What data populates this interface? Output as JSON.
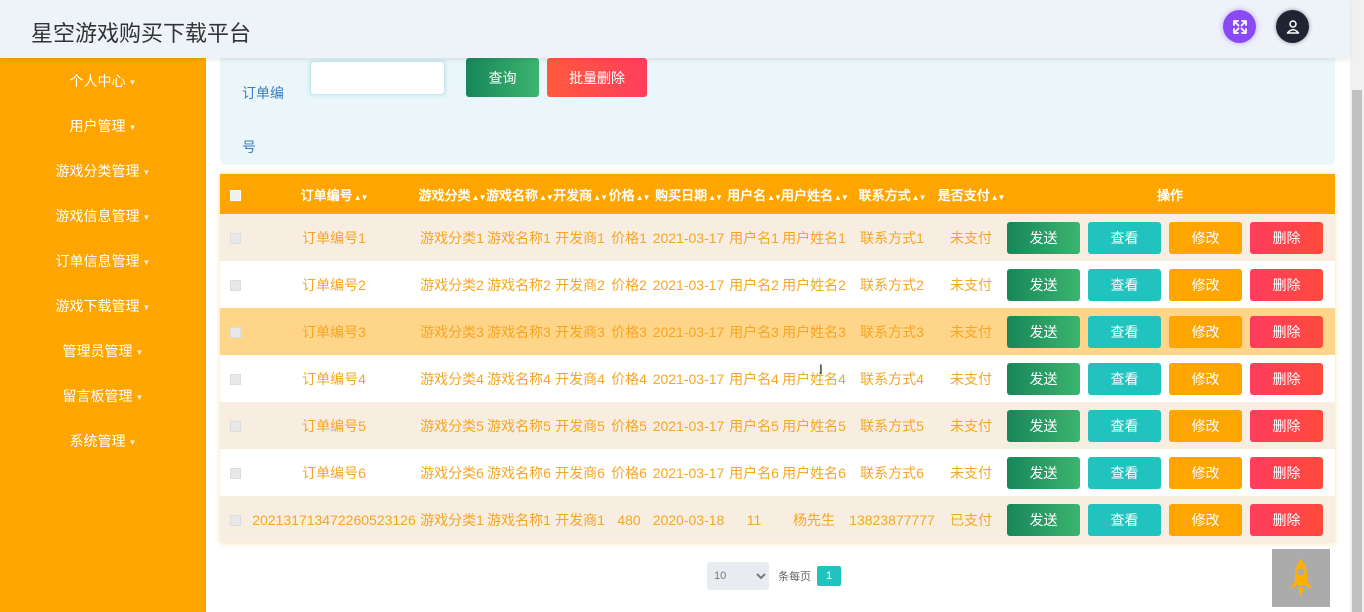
{
  "app": {
    "title": "星空游戏购买下载平台"
  },
  "header": {
    "icons": [
      "fullscreen-icon",
      "user-icon"
    ]
  },
  "sidebar": {
    "items": [
      {
        "label": "个人中心"
      },
      {
        "label": "用户管理"
      },
      {
        "label": "游戏分类管理"
      },
      {
        "label": "游戏信息管理"
      },
      {
        "label": "订单信息管理"
      },
      {
        "label": "游戏下载管理"
      },
      {
        "label": "管理员管理"
      },
      {
        "label": "留言板管理"
      },
      {
        "label": "系统管理"
      }
    ]
  },
  "search": {
    "label": "订单编号",
    "value": "",
    "placeholder": "",
    "query_label": "查询",
    "batch_delete_label": "批量删除"
  },
  "table": {
    "columns": [
      "订单编号",
      "游戏分类",
      "游戏名称",
      "开发商",
      "价格",
      "购买日期",
      "用户名",
      "用户姓名",
      "联系方式",
      "是否支付",
      "操作"
    ],
    "actions": {
      "send": "发送",
      "view": "查看",
      "edit": "修改",
      "delete": "删除"
    },
    "rows": [
      [
        "订单编号1",
        "游戏分类1",
        "游戏名称1",
        "开发商1",
        "价格1",
        "2021-03-17",
        "用户名1",
        "用户姓名1",
        "联系方式1",
        "未支付"
      ],
      [
        "订单编号2",
        "游戏分类2",
        "游戏名称2",
        "开发商2",
        "价格2",
        "2021-03-17",
        "用户名2",
        "用户姓名2",
        "联系方式2",
        "未支付"
      ],
      [
        "订单编号3",
        "游戏分类3",
        "游戏名称3",
        "开发商3",
        "价格3",
        "2021-03-17",
        "用户名3",
        "用户姓名3",
        "联系方式3",
        "未支付"
      ],
      [
        "订单编号4",
        "游戏分类4",
        "游戏名称4",
        "开发商4",
        "价格4",
        "2021-03-17",
        "用户名4",
        "用户姓名4",
        "联系方式4",
        "未支付"
      ],
      [
        "订单编号5",
        "游戏分类5",
        "游戏名称5",
        "开发商5",
        "价格5",
        "2021-03-17",
        "用户名5",
        "用户姓名5",
        "联系方式5",
        "未支付"
      ],
      [
        "订单编号6",
        "游戏分类6",
        "游戏名称6",
        "开发商6",
        "价格6",
        "2021-03-17",
        "用户名6",
        "用户姓名6",
        "联系方式6",
        "未支付"
      ],
      [
        "20213171347226052312​6",
        "游戏分类1",
        "游戏名称1",
        "开发商1",
        "480",
        "2020-03-18",
        "11",
        "杨先生",
        "13823877777",
        "已支付"
      ]
    ]
  },
  "pagination": {
    "page_size": "10",
    "page_size_options": [
      "10"
    ],
    "per_page_label": "条每页",
    "current_page": "1"
  },
  "colors": {
    "sidebar": "#ffa500",
    "accent_purple": "#8a4af3",
    "send": "#17865a",
    "view": "#20c3bd",
    "edit": "#ffa500",
    "delete": "#ff3d5e"
  }
}
